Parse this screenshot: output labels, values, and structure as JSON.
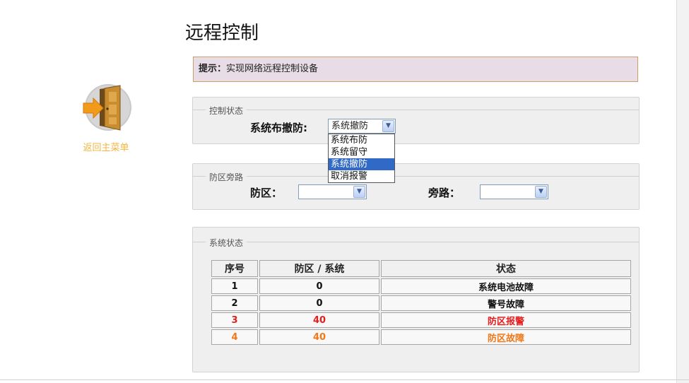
{
  "page_title": "远程控制",
  "home": {
    "label": "返回主菜单",
    "icon": "door-exit-icon"
  },
  "hint": {
    "label": "提示：",
    "text": "实现网络远程控制设备"
  },
  "control": {
    "legend": "控制状态",
    "arm_label": "系统布撤防:",
    "selected": "系统撤防",
    "options": [
      "系统布防",
      "系统留守",
      "系统撤防",
      "取消报警"
    ],
    "highlighted_index": 2
  },
  "bypass": {
    "legend": "防区旁路",
    "zone_label": "防区：",
    "zone_value": "",
    "bypass_label": "旁路：",
    "bypass_value": ""
  },
  "status": {
    "legend": "系统状态",
    "columns": [
      "序号",
      "防区 / 系统",
      "状态"
    ],
    "rows": [
      {
        "no": "1",
        "zone": "0",
        "state": "系统电池故障",
        "color": "#111111"
      },
      {
        "no": "2",
        "zone": "0",
        "state": "警号故障",
        "color": "#111111"
      },
      {
        "no": "3",
        "zone": "40",
        "state": "防区报警",
        "color": "#e51d1d"
      },
      {
        "no": "4",
        "zone": "40",
        "state": "防区故障",
        "color": "#f07818"
      }
    ]
  },
  "colors": {
    "hint_bg": "#e8dde6",
    "hint_border": "#c9a06a",
    "home_label": "#f0b640",
    "highlight": "#3169c6"
  }
}
